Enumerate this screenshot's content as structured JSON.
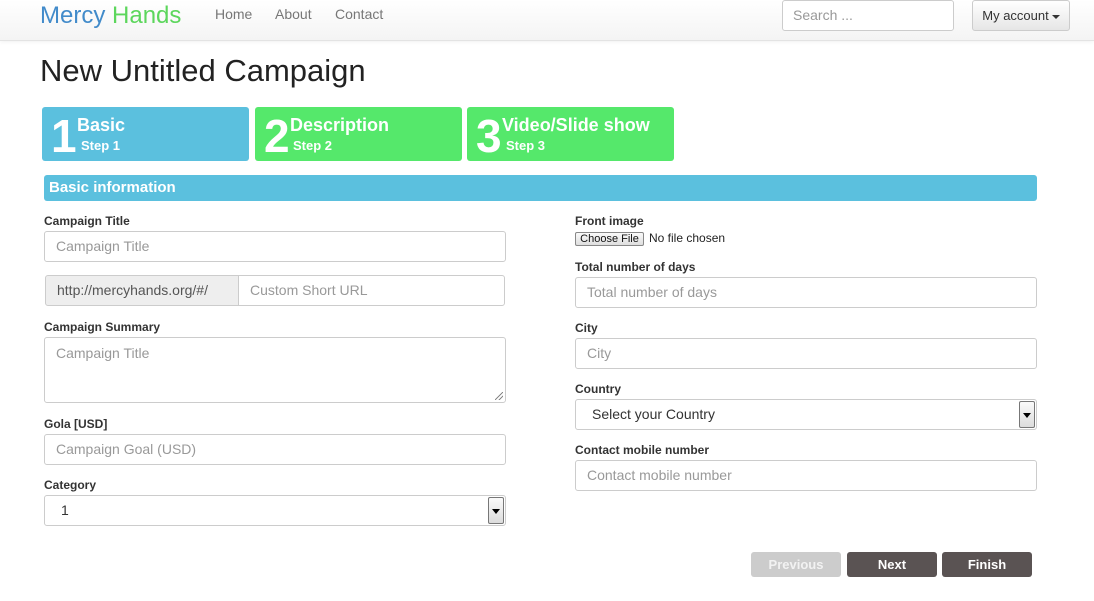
{
  "brand": {
    "part1": "Mercy",
    "part2": "Hands"
  },
  "nav": {
    "home": "Home",
    "about": "About",
    "contact": "Contact"
  },
  "search": {
    "placeholder": "Search ..."
  },
  "account": {
    "label": "My account"
  },
  "page": {
    "title": "New Untitled Campaign"
  },
  "steps": [
    {
      "number": "1",
      "title": "Basic",
      "sub": "Step 1",
      "color": "#5bc0de"
    },
    {
      "number": "2",
      "title": "Description",
      "sub": "Step 2",
      "color": "#55e86b"
    },
    {
      "number": "3",
      "title": "Video/Slide show",
      "sub": "Step 3",
      "color": "#55e86b"
    }
  ],
  "section": {
    "title": "Basic information"
  },
  "form": {
    "campaign_title": {
      "label": "Campaign Title",
      "placeholder": "Campaign Title"
    },
    "url": {
      "prefix": "http://mercyhands.org/#/",
      "placeholder": "Custom Short URL"
    },
    "summary": {
      "label": "Campaign Summary",
      "placeholder": "Campaign Title"
    },
    "goal": {
      "label": "Gola [USD]",
      "placeholder": "Campaign Goal (USD)"
    },
    "category": {
      "label": "Category",
      "value": "1"
    },
    "front_image": {
      "label": "Front image",
      "button": "Choose File",
      "status": "No file chosen"
    },
    "days": {
      "label": "Total number of days",
      "placeholder": "Total number of days"
    },
    "city": {
      "label": "City",
      "placeholder": "City"
    },
    "country": {
      "label": "Country",
      "value": "Select your Country"
    },
    "mobile": {
      "label": "Contact mobile number",
      "placeholder": "Contact mobile number"
    }
  },
  "buttons": {
    "previous": "Previous",
    "next": "Next",
    "finish": "Finish"
  }
}
